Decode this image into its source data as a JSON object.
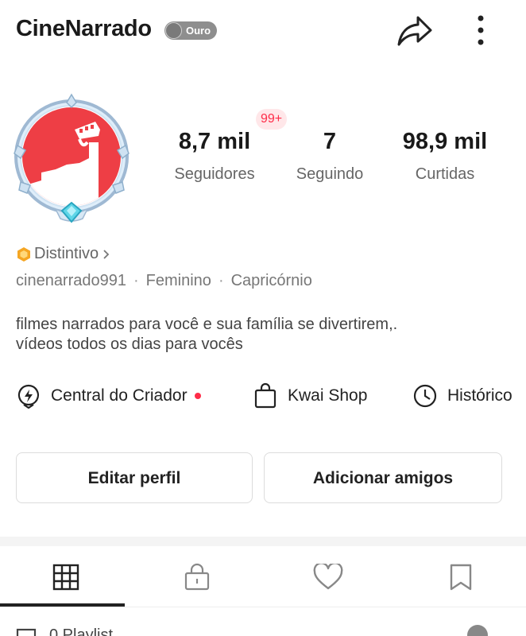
{
  "header": {
    "title": "CineNarrado",
    "level_badge": "Ouro"
  },
  "avatar": {
    "alt": "CineNarrado"
  },
  "notification_badge": "99+",
  "stats": [
    {
      "value": "8,7 mil",
      "label": "Seguidores"
    },
    {
      "value": "7",
      "label": "Seguindo"
    },
    {
      "value": "98,9 mil",
      "label": "Curtidas"
    }
  ],
  "profile": {
    "badge_link": "Distintivo",
    "username": "cinenarrado991",
    "gender": "Feminino",
    "sign": "Capricórnio",
    "bio_line1": "filmes narrados para você e sua família se divertirem,.",
    "bio_line2": "vídeos todos os dias para vocês"
  },
  "quick_links": [
    {
      "label": "Central do Criador",
      "icon": "creator-center-icon",
      "has_dot": true
    },
    {
      "label": "Kwai Shop",
      "icon": "shopping-bag-icon",
      "has_dot": false
    },
    {
      "label": "Histórico",
      "icon": "clock-icon",
      "has_dot": false
    }
  ],
  "actions": {
    "edit_profile": "Editar perfil",
    "add_friends": "Adicionar amigos"
  },
  "tabs": [
    {
      "icon": "grid-icon",
      "active": true
    },
    {
      "icon": "lock-icon",
      "active": false
    },
    {
      "icon": "heart-icon",
      "active": false
    },
    {
      "icon": "bookmark-icon",
      "active": false
    }
  ],
  "playlist": {
    "label": "0 Playlist"
  },
  "colors": {
    "accent_red": "#fe2c48",
    "badge_gold": "#f5a623",
    "avatar_red": "#ee3e45",
    "text_primary": "#1a1a1a",
    "text_secondary": "#666666"
  }
}
